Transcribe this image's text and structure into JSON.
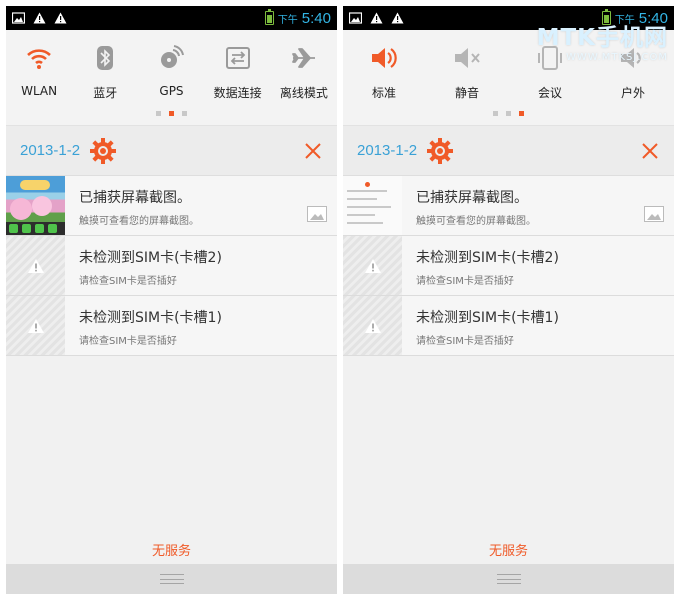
{
  "colors": {
    "accent": "#f05a28",
    "date_blue": "#3aa1d6",
    "clock_blue": "#33b5e5",
    "battery_green": "#7dbd3e"
  },
  "status_bar": {
    "ampm": "下午",
    "time": "5:40",
    "icons": [
      "image-icon",
      "warning-icon",
      "warning-icon"
    ]
  },
  "left_panel": {
    "quick_toggles": [
      {
        "label": "WLAN",
        "icon": "wifi-icon",
        "active": true
      },
      {
        "label": "蓝牙",
        "icon": "bluetooth-icon",
        "active": false
      },
      {
        "label": "GPS",
        "icon": "gps-icon",
        "active": false
      },
      {
        "label": "数据连接",
        "icon": "data-connection-icon",
        "active": false
      },
      {
        "label": "离线模式",
        "icon": "airplane-icon",
        "active": false
      }
    ],
    "page_index": 2,
    "page_count": 3
  },
  "right_panel": {
    "quick_toggles": [
      {
        "label": "标准",
        "icon": "speaker-icon",
        "active": true
      },
      {
        "label": "静音",
        "icon": "mute-icon",
        "active": false
      },
      {
        "label": "会议",
        "icon": "meeting-icon",
        "active": false
      },
      {
        "label": "户外",
        "icon": "outdoor-icon",
        "active": false
      }
    ],
    "page_index": 3,
    "page_count": 3
  },
  "date": "2013-1-2",
  "notifications": [
    {
      "title": "已捕获屏幕截图。",
      "subtitle": "触摸可查看您的屏幕截图。",
      "type": "screenshot"
    },
    {
      "title": "未检测到SIM卡(卡槽2)",
      "subtitle": "请检查SIM卡是否插好",
      "type": "warning"
    },
    {
      "title": "未检测到SIM卡(卡槽1)",
      "subtitle": "请检查SIM卡是否插好",
      "type": "warning"
    }
  ],
  "no_service": "无服务",
  "watermark": {
    "main": "MTK手机网",
    "url": "WWW.MTKSJ.COM"
  }
}
